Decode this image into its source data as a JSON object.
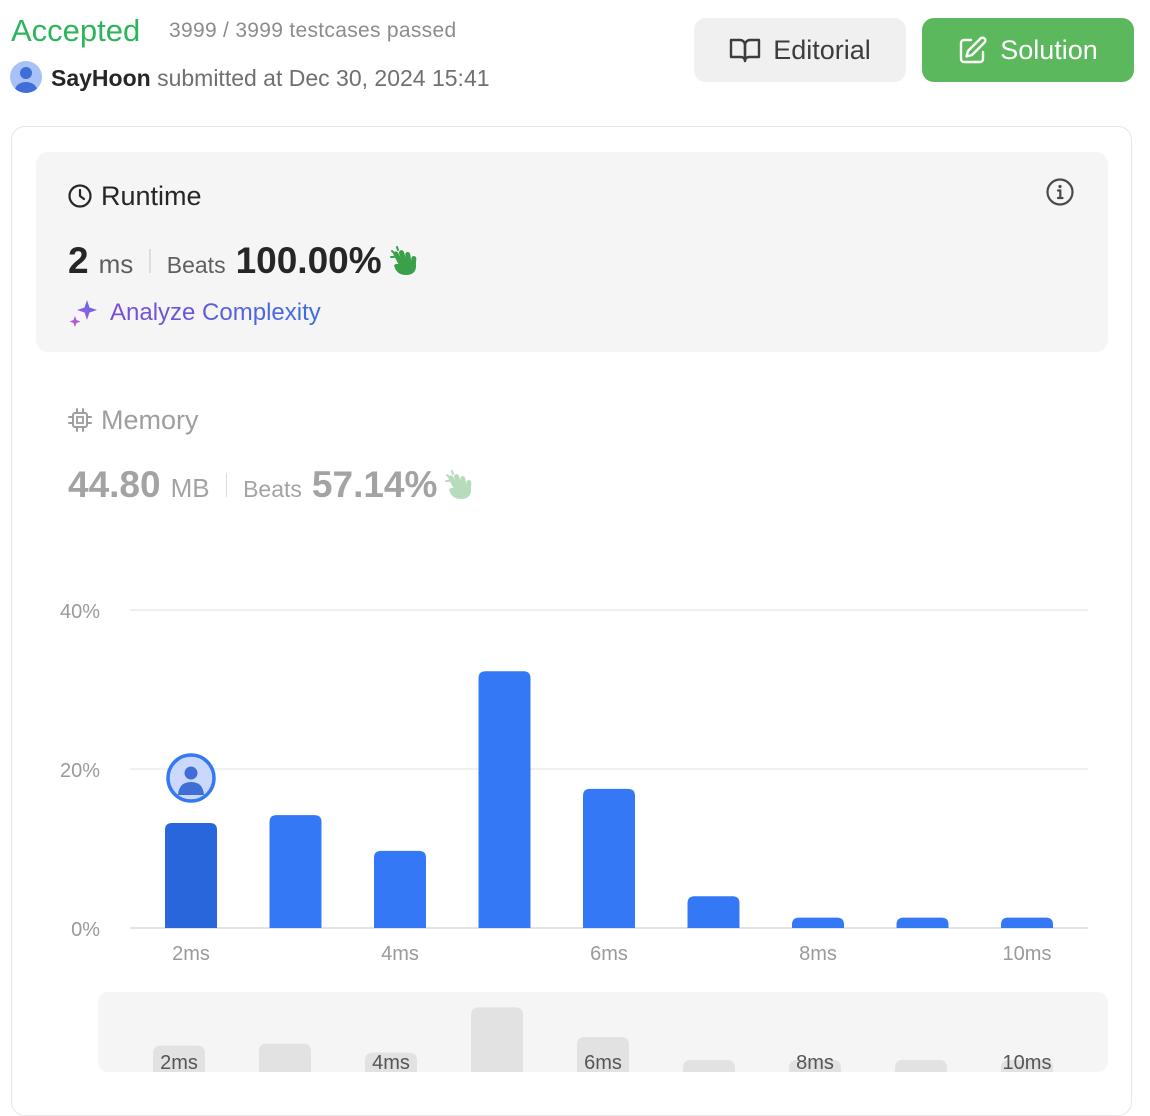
{
  "header": {
    "status": "Accepted",
    "testcases": "3999 / 3999 testcases passed",
    "username": "SayHoon",
    "submitted_text": "submitted at Dec 30, 2024 15:41",
    "editorial_label": "Editorial",
    "solution_label": "Solution"
  },
  "runtime": {
    "title": "Runtime",
    "value": "2",
    "unit": "ms",
    "beats_label": "Beats",
    "beats_value": "100.00%",
    "analyze_label": "Analyze Complexity"
  },
  "memory": {
    "title": "Memory",
    "value": "44.80",
    "unit": "MB",
    "beats_label": "Beats",
    "beats_value": "57.14%"
  },
  "colors": {
    "accent_green": "#2db55d",
    "solution_green": "#5cb85c",
    "bar_blue": "#3478f6",
    "bar_selected": "#2a66db"
  },
  "chart_data": {
    "type": "bar",
    "title": "",
    "xlabel": "",
    "ylabel": "",
    "x_unit": "ms",
    "x": [
      2,
      3,
      4,
      5,
      6,
      7,
      8,
      9,
      10
    ],
    "values": [
      13.2,
      14.2,
      9.7,
      32.3,
      17.5,
      4.0,
      1.3,
      1.3,
      1.3
    ],
    "highlight_x": 2,
    "ylim": [
      0,
      40
    ],
    "y_ticks": [
      "0%",
      "20%",
      "40%"
    ],
    "x_ticks": [
      "2ms",
      "4ms",
      "6ms",
      "8ms",
      "10ms"
    ],
    "grid": true
  },
  "overview": {
    "x_ticks": [
      "2ms",
      "4ms",
      "6ms",
      "8ms",
      "10ms"
    ]
  }
}
